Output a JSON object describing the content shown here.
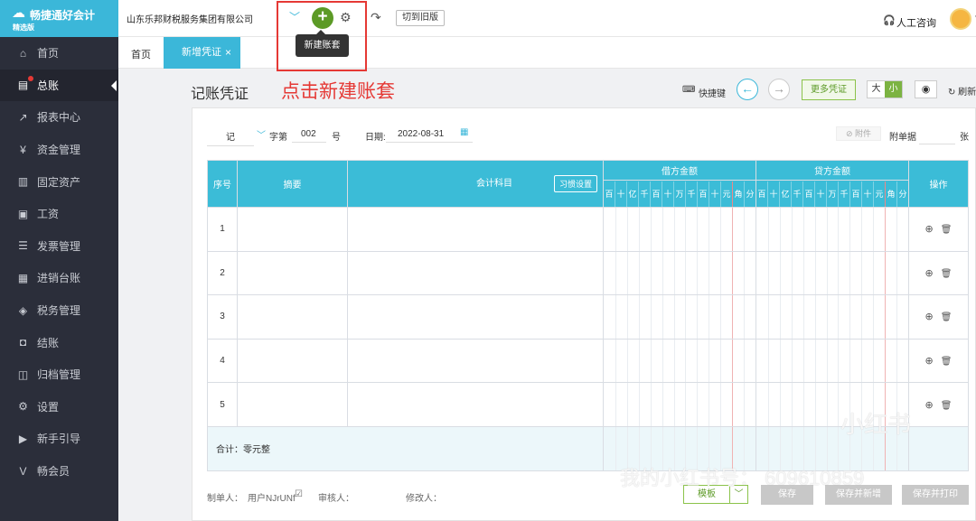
{
  "app": {
    "name": "畅捷通好会计",
    "edition": "精选版",
    "company": "山东乐邦财税服务集团有限公司",
    "switch_label": "切到旧版",
    "support_label": "人工咨询",
    "tooltip": "新建账套",
    "annotation": "点击新建账套"
  },
  "sidebar": {
    "items": [
      {
        "label": "首页",
        "icon": "home-icon"
      },
      {
        "label": "总账",
        "icon": "ledger-icon",
        "active": true
      },
      {
        "label": "报表中心",
        "icon": "chart-icon"
      },
      {
        "label": "资金管理",
        "icon": "money-icon"
      },
      {
        "label": "固定资产",
        "icon": "asset-icon"
      },
      {
        "label": "工资",
        "icon": "salary-icon"
      },
      {
        "label": "发票管理",
        "icon": "invoice-icon"
      },
      {
        "label": "进销台账",
        "icon": "inventory-icon"
      },
      {
        "label": "税务管理",
        "icon": "tax-icon"
      },
      {
        "label": "结账",
        "icon": "close-books-icon"
      },
      {
        "label": "归档管理",
        "icon": "archive-icon"
      },
      {
        "label": "设置",
        "icon": "gear-icon"
      },
      {
        "label": "新手引导",
        "icon": "guide-icon"
      },
      {
        "label": "畅会员",
        "icon": "vip-icon"
      }
    ]
  },
  "tabs": {
    "home": "首页",
    "active": "新增凭证",
    "close": "×"
  },
  "voucher": {
    "title": "记账凭证",
    "shortcut_label": "快捷键",
    "more_label": "更多凭证",
    "size_large": "大",
    "size_small": "小",
    "refresh_label": "刷新",
    "word": "记",
    "word_suffix": "字第",
    "number": "002",
    "number_suffix": "号",
    "date_label": "日期:",
    "date": "2022-08-31",
    "attach_label": "附件",
    "attach_count_label": "附单据",
    "attach_unit": "张",
    "columns": {
      "seq": "序号",
      "summary": "摘要",
      "account": "会计科目",
      "settings": "习惯设置",
      "debit": "借方金额",
      "credit": "贷方金额",
      "ops": "操作"
    },
    "digits": [
      "百",
      "十",
      "亿",
      "千",
      "百",
      "十",
      "万",
      "千",
      "百",
      "十",
      "元",
      "角",
      "分"
    ],
    "rows": [
      "1",
      "2",
      "3",
      "4",
      "5"
    ],
    "total_label": "合计：零元整",
    "maker_label": "制单人：",
    "maker": "用户NJrUNf",
    "reviewer_label": "审核人：",
    "modifier_label": "修改人："
  },
  "buttons": {
    "template": "模板",
    "save": "保存",
    "save_new": "保存并新增",
    "save_print": "保存并打印"
  },
  "watermarks": {
    "logo": "小红书",
    "id": "我的小红书号：  609610859"
  }
}
